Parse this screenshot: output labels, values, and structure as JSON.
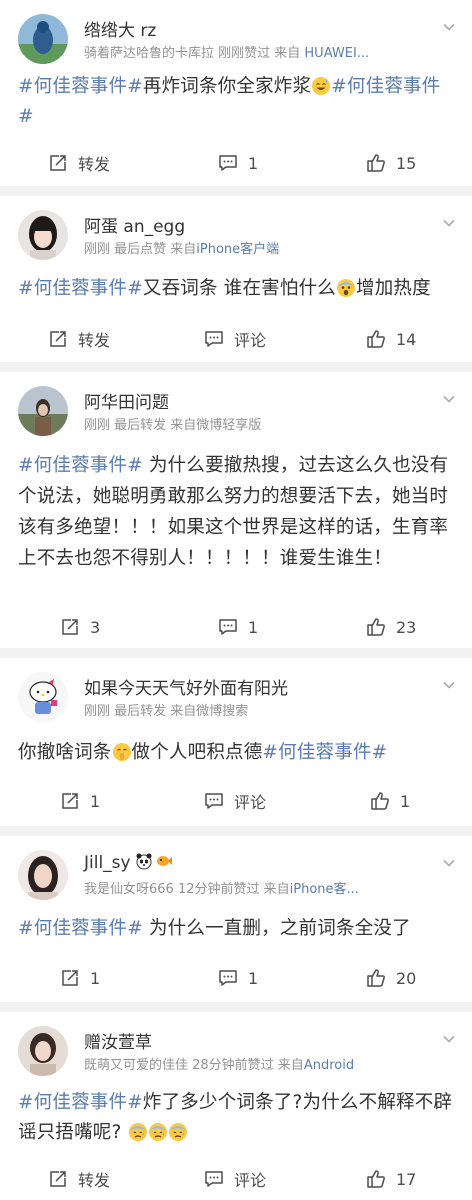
{
  "posts": [
    {
      "username": "绺绺大 rz",
      "meta_prefix": "骑着萨达哈鲁的卡库拉  刚刚赞过  来自 ",
      "meta_source": "HUAWEI...",
      "content": [
        {
          "t": "#何佳蓉事件#",
          "tag": true
        },
        {
          "t": "再炸词条你全家炸浆"
        },
        {
          "emoji": "sweat-smile-emoji"
        },
        {
          "t": "#何佳蓉事件#",
          "tag": true
        }
      ],
      "actions": {
        "repost": "转发",
        "comment": "1",
        "like": "15"
      }
    },
    {
      "username": "阿蛋 an_egg",
      "meta_prefix": "刚刚  最后点赞  来自",
      "meta_source": "iPhone客户端",
      "content": [
        {
          "t": "#何佳蓉事件#",
          "tag": true
        },
        {
          "t": "又吞词条 谁在害怕什么"
        },
        {
          "emoji": "scared-emoji"
        },
        {
          "t": "增加热度"
        }
      ],
      "actions": {
        "repost": "转发",
        "comment": "评论",
        "like": "14"
      }
    },
    {
      "username": "阿华田问题",
      "meta_prefix": "刚刚  最后转发  来自微博轻享版",
      "meta_source": "",
      "content": [
        {
          "t": "#何佳蓉事件#",
          "tag": true
        },
        {
          "t": " 为什么要撤热搜，过去这么久也没有个说法，她聪明勇敢那么努力的想要活下去，她当时该有多绝望！！！如果这个世界是这样的话，生育率上不去也怨不得别人！！！！！谁爱生谁生！"
        }
      ],
      "actions": {
        "repost": "3",
        "comment": "1",
        "like": "23"
      }
    },
    {
      "username": "如果今天天气好外面有阳光",
      "meta_prefix": "刚刚  最后转发  来自微博搜索",
      "meta_source": "",
      "content": [
        {
          "t": "你撤啥词条"
        },
        {
          "emoji": "shush-emoji"
        },
        {
          "t": "做个人吧积点德"
        },
        {
          "t": "#何佳蓉事件#",
          "tag": true
        }
      ],
      "actions": {
        "repost": "1",
        "comment": "评论",
        "like": "1"
      }
    },
    {
      "username": "Jill_sy",
      "meta_prefix": "我是仙女呀666  12分钟前赞过  来自",
      "meta_source": "iPhone客...",
      "content": [
        {
          "t": "#何佳蓉事件#",
          "tag": true
        },
        {
          "t": " 为什么一直删，之前词条全没了"
        }
      ],
      "actions": {
        "repost": "1",
        "comment": "1",
        "like": "20"
      }
    },
    {
      "username": "赠汝萱草",
      "meta_prefix": "既萌又可爱的佳佳  28分钟前赞过  来自",
      "meta_source": "Android",
      "content": [
        {
          "t": "#何佳蓉事件#",
          "tag": true
        },
        {
          "t": "炸了多少个词条了?为什么不解释不辟谣只捂嘴呢? "
        },
        {
          "emoji": "sad-sweat-emoji"
        },
        {
          "emoji": "sad-sweat-emoji"
        },
        {
          "emoji": "sad-sweat-emoji"
        }
      ],
      "actions": {
        "repost": "转发",
        "comment": "评论",
        "like": "17"
      }
    }
  ],
  "colors": {
    "tag": "#5b7cb0",
    "meta": "#939393",
    "background": "#f2f2f2"
  }
}
